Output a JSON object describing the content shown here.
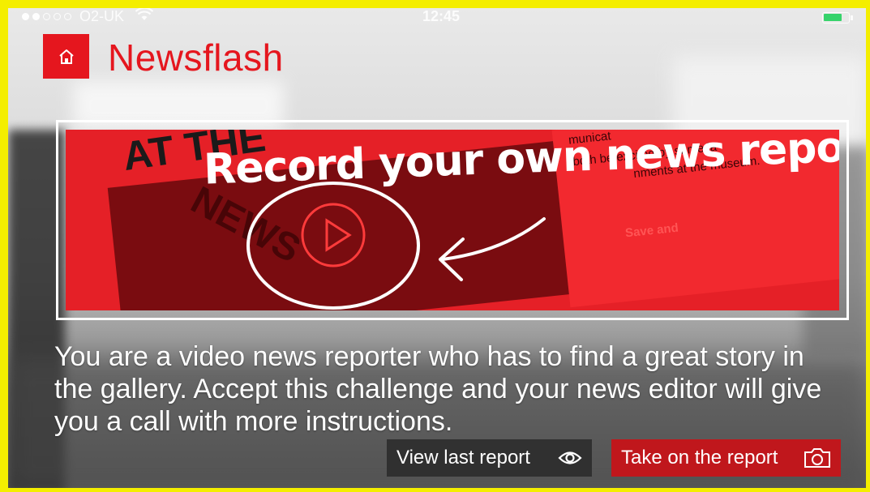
{
  "status_bar": {
    "carrier": "O2-UK",
    "time": "12:45",
    "signal_dots_filled": 2,
    "signal_dots_total": 5,
    "battery_level": 0.8
  },
  "header": {
    "title": "Newsflash",
    "home_icon": "home-icon"
  },
  "banner": {
    "headline": "Record your own news report",
    "newspaper_heading": "AT THE",
    "stamp_text": "NEWS",
    "paper_lines": [
      "municat",
      "both be excited by some la",
      "nments at the museum.",
      "Save and"
    ]
  },
  "description": "You are a video news reporter who has to find a great story in the gallery. Accept this challenge and your news editor will give you a call with more instructions.",
  "actions": {
    "view_label": "View last report",
    "view_icon": "eye-icon",
    "take_label": "Take on the report",
    "take_icon": "camera-icon"
  },
  "colors": {
    "brand_red": "#e5161e",
    "frame_yellow": "#f4ee00",
    "battery_green": "#36d36b"
  }
}
